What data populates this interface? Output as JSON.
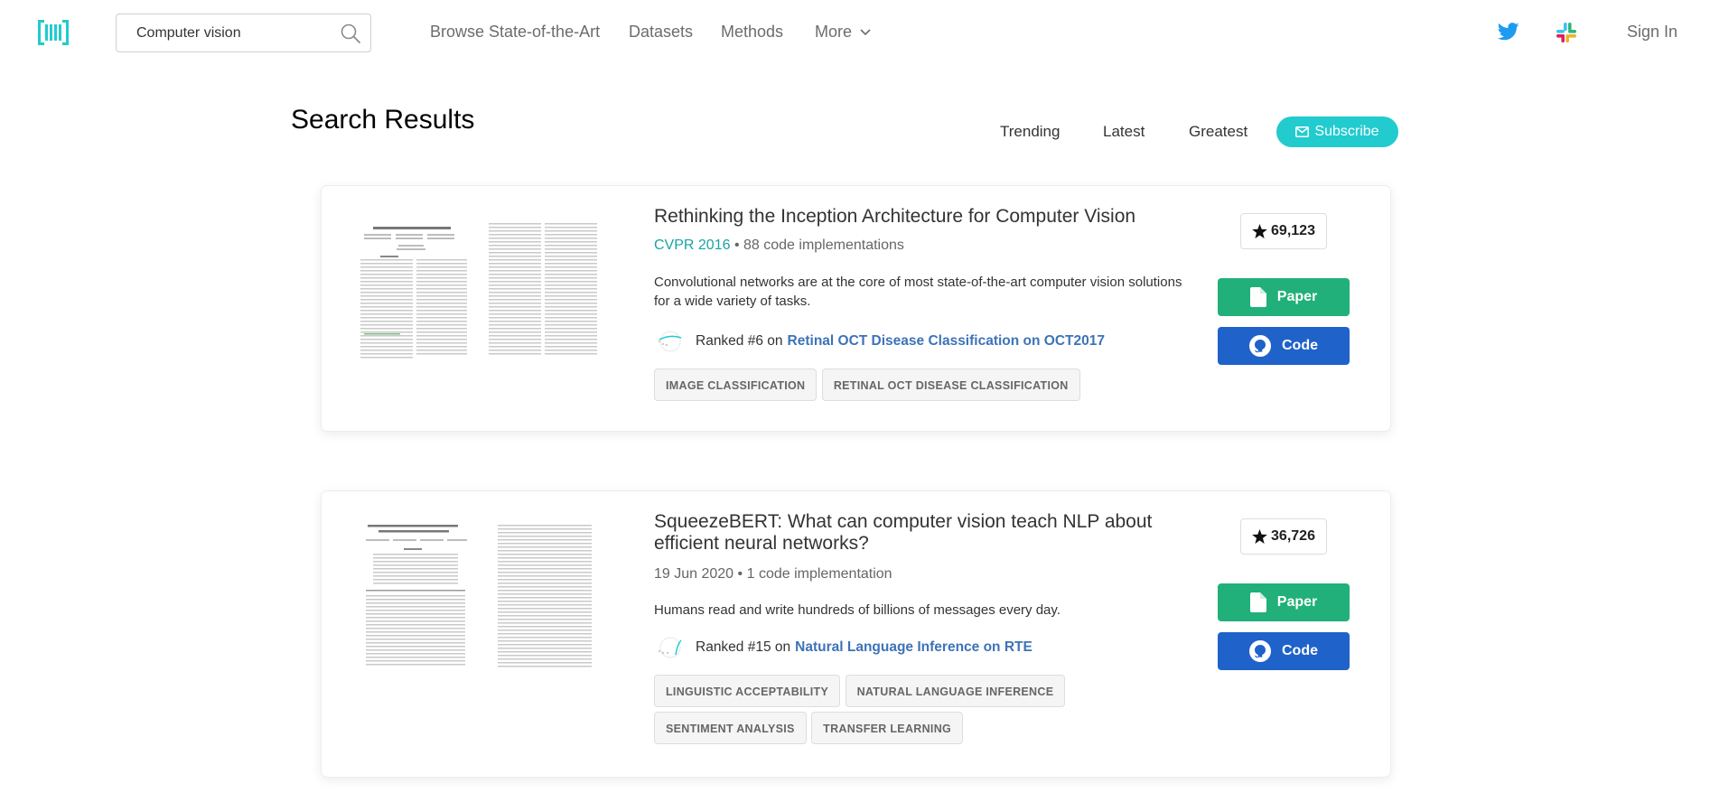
{
  "nav": {
    "search_value": "Computer vision",
    "links": [
      "Browse State-of-the-Art",
      "Datasets",
      "Methods",
      "More"
    ],
    "sign_in": "Sign In"
  },
  "header": {
    "title": "Search Results",
    "filters": [
      "Trending",
      "Latest",
      "Greatest"
    ],
    "subscribe": "Subscribe"
  },
  "papers": [
    {
      "title": "Rethinking the Inception Architecture for Computer Vision",
      "conference": "CVPR 2016",
      "implementations": "88 code implementations",
      "abstract": "Convolutional networks are at the core of most state-of-the-art computer vision solutions for a wide variety of tasks.",
      "rank_prefix": "Ranked #6 on",
      "rank_task": "Retinal OCT Disease Classification on OCT2017",
      "tags": [
        "IMAGE CLASSIFICATION",
        "RETINAL OCT DISEASE CLASSIFICATION"
      ],
      "stars": "69,123",
      "paper_btn": "Paper",
      "code_btn": "Code"
    },
    {
      "title": "SqueezeBERT: What can computer vision teach NLP about efficient neural networks?",
      "date": "19 Jun 2020",
      "implementations": "1 code implementation",
      "abstract": "Humans read and write hundreds of billions of messages every day.",
      "rank_prefix": "Ranked #15 on",
      "rank_task": "Natural Language Inference on RTE",
      "tags": [
        "LINGUISTIC ACCEPTABILITY",
        "NATURAL LANGUAGE INFERENCE",
        "SENTIMENT ANALYSIS",
        "TRANSFER LEARNING"
      ],
      "stars": "36,726",
      "paper_btn": "Paper",
      "code_btn": "Code"
    }
  ],
  "colors": {
    "brand_teal": "#21cbce",
    "paper_green": "#21b07a",
    "code_blue": "#1f62c9",
    "link_blue": "#3d73b8"
  },
  "icons": [
    "logo-icon",
    "search-icon",
    "chevron-down-icon",
    "twitter-icon",
    "slack-icon",
    "mail-icon",
    "star-icon",
    "document-icon",
    "github-icon",
    "rank-chart-icon"
  ]
}
